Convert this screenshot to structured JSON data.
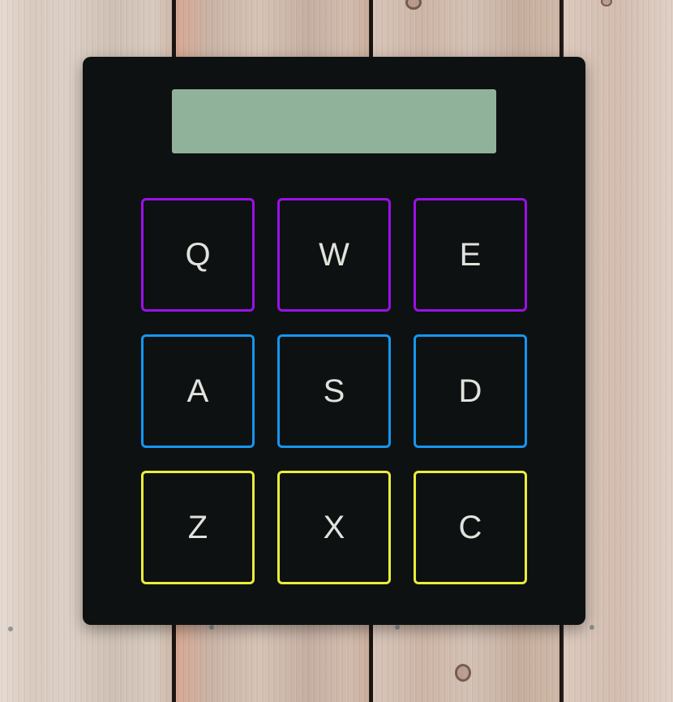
{
  "display": {
    "value": ""
  },
  "keypad": {
    "rows": [
      {
        "color": "#9b10e8",
        "keys": [
          "Q",
          "W",
          "E"
        ]
      },
      {
        "color": "#1596f0",
        "keys": [
          "A",
          "S",
          "D"
        ]
      },
      {
        "color": "#eaec3a",
        "keys": [
          "Z",
          "X",
          "C"
        ]
      }
    ]
  },
  "colors": {
    "device_body": "#0d1112",
    "display_background": "#91b29a",
    "key_label": "#e2e2dc"
  }
}
